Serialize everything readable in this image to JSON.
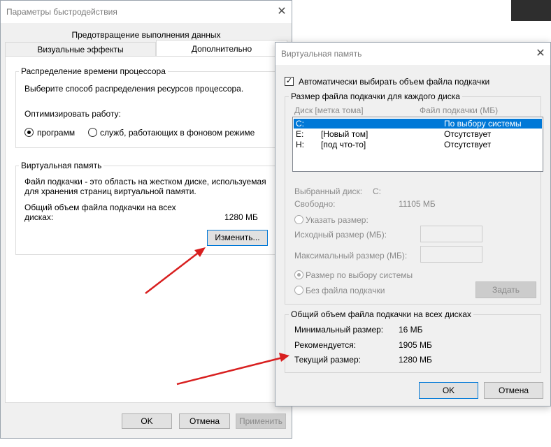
{
  "perf_window": {
    "title": "Параметры быстродействия",
    "tabs": {
      "dep": "Предотвращение выполнения данных",
      "visual": "Визуальные эффекты",
      "advanced": "Дополнительно"
    },
    "cpu": {
      "group_title": "Распределение времени процессора",
      "description": "Выберите способ распределения ресурсов процессора.",
      "optimize_label": "Оптимизировать работу:",
      "radio_programs": "программ",
      "radio_services": "служб, работающих в фоновом режиме"
    },
    "vm": {
      "group_title": "Виртуальная память",
      "desc_line1": "Файл подкачки - это область на жестком диске, используемая",
      "desc_line2": "для хранения страниц виртуальной памяти.",
      "total_label_line1": "Общий объем файла подкачки на всех",
      "total_label_line2": "дисках:",
      "total_value": "1280 МБ",
      "change_button": "Изменить..."
    },
    "buttons": {
      "ok": "OK",
      "cancel": "Отмена",
      "apply": "Применить"
    }
  },
  "vm_dialog": {
    "title": "Виртуальная память",
    "auto_checkbox": "Автоматически выбирать объем файла подкачки",
    "per_drive_group": "Размер файла подкачки для каждого диска",
    "columns": {
      "drive": "Диск [метка тома]",
      "pagefile": "Файл подкачки (МБ)"
    },
    "drives": [
      {
        "drive": "C:",
        "label": "",
        "pagefile": "По выбору системы"
      },
      {
        "drive": "E:",
        "label": "[Новый том]",
        "pagefile": "Отсутствует"
      },
      {
        "drive": "H:",
        "label": "[под что-то]",
        "pagefile": "Отсутствует"
      }
    ],
    "selected_drive_label": "Выбранный диск:",
    "selected_drive_value": "C:",
    "free_label": "Свободно:",
    "free_value": "11105 МБ",
    "custom_size_radio": "Указать размер:",
    "initial_size_label": "Исходный размер (МБ):",
    "max_size_label": "Максимальный размер (МБ):",
    "system_managed_radio": "Размер по выбору системы",
    "no_pagefile_radio": "Без файла подкачки",
    "set_button": "Задать",
    "total_group": "Общий объем файла подкачки на всех дисках",
    "min_label": "Минимальный размер:",
    "min_value": "16 МБ",
    "recommended_label": "Рекомендуется:",
    "recommended_value": "1905 МБ",
    "current_label": "Текущий размер:",
    "current_value": "1280 МБ",
    "ok": "OK",
    "cancel": "Отмена"
  },
  "annotation_color": "#d81f1f"
}
